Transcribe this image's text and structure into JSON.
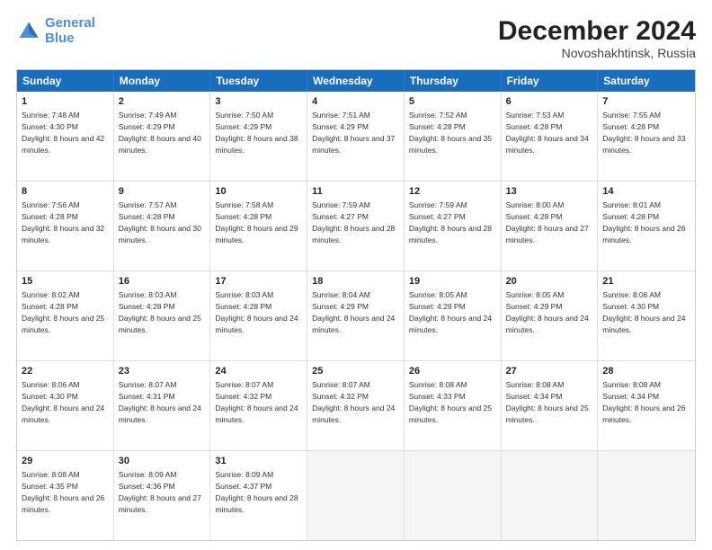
{
  "header": {
    "logo_line1": "General",
    "logo_line2": "Blue",
    "month_year": "December 2024",
    "location": "Novoshakhtinsk, Russia"
  },
  "days_of_week": [
    "Sunday",
    "Monday",
    "Tuesday",
    "Wednesday",
    "Thursday",
    "Friday",
    "Saturday"
  ],
  "weeks": [
    [
      {
        "day": "1",
        "sunrise": "Sunrise: 7:48 AM",
        "sunset": "Sunset: 4:30 PM",
        "daylight": "Daylight: 8 hours and 42 minutes."
      },
      {
        "day": "2",
        "sunrise": "Sunrise: 7:49 AM",
        "sunset": "Sunset: 4:29 PM",
        "daylight": "Daylight: 8 hours and 40 minutes."
      },
      {
        "day": "3",
        "sunrise": "Sunrise: 7:50 AM",
        "sunset": "Sunset: 4:29 PM",
        "daylight": "Daylight: 8 hours and 38 minutes."
      },
      {
        "day": "4",
        "sunrise": "Sunrise: 7:51 AM",
        "sunset": "Sunset: 4:29 PM",
        "daylight": "Daylight: 8 hours and 37 minutes."
      },
      {
        "day": "5",
        "sunrise": "Sunrise: 7:52 AM",
        "sunset": "Sunset: 4:28 PM",
        "daylight": "Daylight: 8 hours and 35 minutes."
      },
      {
        "day": "6",
        "sunrise": "Sunrise: 7:53 AM",
        "sunset": "Sunset: 4:28 PM",
        "daylight": "Daylight: 8 hours and 34 minutes."
      },
      {
        "day": "7",
        "sunrise": "Sunrise: 7:55 AM",
        "sunset": "Sunset: 4:28 PM",
        "daylight": "Daylight: 8 hours and 33 minutes."
      }
    ],
    [
      {
        "day": "8",
        "sunrise": "Sunrise: 7:56 AM",
        "sunset": "Sunset: 4:28 PM",
        "daylight": "Daylight: 8 hours and 32 minutes."
      },
      {
        "day": "9",
        "sunrise": "Sunrise: 7:57 AM",
        "sunset": "Sunset: 4:28 PM",
        "daylight": "Daylight: 8 hours and 30 minutes."
      },
      {
        "day": "10",
        "sunrise": "Sunrise: 7:58 AM",
        "sunset": "Sunset: 4:28 PM",
        "daylight": "Daylight: 8 hours and 29 minutes."
      },
      {
        "day": "11",
        "sunrise": "Sunrise: 7:59 AM",
        "sunset": "Sunset: 4:27 PM",
        "daylight": "Daylight: 8 hours and 28 minutes."
      },
      {
        "day": "12",
        "sunrise": "Sunrise: 7:59 AM",
        "sunset": "Sunset: 4:27 PM",
        "daylight": "Daylight: 8 hours and 28 minutes."
      },
      {
        "day": "13",
        "sunrise": "Sunrise: 8:00 AM",
        "sunset": "Sunset: 4:28 PM",
        "daylight": "Daylight: 8 hours and 27 minutes."
      },
      {
        "day": "14",
        "sunrise": "Sunrise: 8:01 AM",
        "sunset": "Sunset: 4:28 PM",
        "daylight": "Daylight: 8 hours and 26 minutes."
      }
    ],
    [
      {
        "day": "15",
        "sunrise": "Sunrise: 8:02 AM",
        "sunset": "Sunset: 4:28 PM",
        "daylight": "Daylight: 8 hours and 25 minutes."
      },
      {
        "day": "16",
        "sunrise": "Sunrise: 8:03 AM",
        "sunset": "Sunset: 4:28 PM",
        "daylight": "Daylight: 8 hours and 25 minutes."
      },
      {
        "day": "17",
        "sunrise": "Sunrise: 8:03 AM",
        "sunset": "Sunset: 4:28 PM",
        "daylight": "Daylight: 8 hours and 24 minutes."
      },
      {
        "day": "18",
        "sunrise": "Sunrise: 8:04 AM",
        "sunset": "Sunset: 4:29 PM",
        "daylight": "Daylight: 8 hours and 24 minutes."
      },
      {
        "day": "19",
        "sunrise": "Sunrise: 8:05 AM",
        "sunset": "Sunset: 4:29 PM",
        "daylight": "Daylight: 8 hours and 24 minutes."
      },
      {
        "day": "20",
        "sunrise": "Sunrise: 8:05 AM",
        "sunset": "Sunset: 4:29 PM",
        "daylight": "Daylight: 8 hours and 24 minutes."
      },
      {
        "day": "21",
        "sunrise": "Sunrise: 8:06 AM",
        "sunset": "Sunset: 4:30 PM",
        "daylight": "Daylight: 8 hours and 24 minutes."
      }
    ],
    [
      {
        "day": "22",
        "sunrise": "Sunrise: 8:06 AM",
        "sunset": "Sunset: 4:30 PM",
        "daylight": "Daylight: 8 hours and 24 minutes."
      },
      {
        "day": "23",
        "sunrise": "Sunrise: 8:07 AM",
        "sunset": "Sunset: 4:31 PM",
        "daylight": "Daylight: 8 hours and 24 minutes."
      },
      {
        "day": "24",
        "sunrise": "Sunrise: 8:07 AM",
        "sunset": "Sunset: 4:32 PM",
        "daylight": "Daylight: 8 hours and 24 minutes."
      },
      {
        "day": "25",
        "sunrise": "Sunrise: 8:07 AM",
        "sunset": "Sunset: 4:32 PM",
        "daylight": "Daylight: 8 hours and 24 minutes."
      },
      {
        "day": "26",
        "sunrise": "Sunrise: 8:08 AM",
        "sunset": "Sunset: 4:33 PM",
        "daylight": "Daylight: 8 hours and 25 minutes."
      },
      {
        "day": "27",
        "sunrise": "Sunrise: 8:08 AM",
        "sunset": "Sunset: 4:34 PM",
        "daylight": "Daylight: 8 hours and 25 minutes."
      },
      {
        "day": "28",
        "sunrise": "Sunrise: 8:08 AM",
        "sunset": "Sunset: 4:34 PM",
        "daylight": "Daylight: 8 hours and 26 minutes."
      }
    ],
    [
      {
        "day": "29",
        "sunrise": "Sunrise: 8:08 AM",
        "sunset": "Sunset: 4:35 PM",
        "daylight": "Daylight: 8 hours and 26 minutes."
      },
      {
        "day": "30",
        "sunrise": "Sunrise: 8:09 AM",
        "sunset": "Sunset: 4:36 PM",
        "daylight": "Daylight: 8 hours and 27 minutes."
      },
      {
        "day": "31",
        "sunrise": "Sunrise: 8:09 AM",
        "sunset": "Sunset: 4:37 PM",
        "daylight": "Daylight: 8 hours and 28 minutes."
      },
      null,
      null,
      null,
      null
    ]
  ]
}
